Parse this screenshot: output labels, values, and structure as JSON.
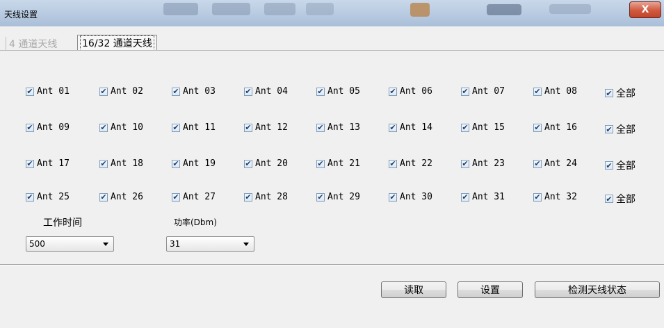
{
  "window": {
    "title": "天线设置",
    "close_glyph": "X"
  },
  "tabs": [
    {
      "label": "4 通道天线",
      "active": false
    },
    {
      "label": "16/32 通道天线",
      "active": true
    }
  ],
  "antennas": {
    "rows": [
      [
        "Ant 01",
        "Ant 02",
        "Ant 03",
        "Ant 04",
        "Ant 05",
        "Ant 06",
        "Ant 07",
        "Ant 08"
      ],
      [
        "Ant 09",
        "Ant 10",
        "Ant 11",
        "Ant 12",
        "Ant 13",
        "Ant 14",
        "Ant 15",
        "Ant 16"
      ],
      [
        "Ant 17",
        "Ant 18",
        "Ant 19",
        "Ant 20",
        "Ant 21",
        "Ant 22",
        "Ant 23",
        "Ant 24"
      ],
      [
        "Ant 25",
        "Ant 26",
        "Ant 27",
        "Ant 28",
        "Ant 29",
        "Ant 30",
        "Ant 31",
        "Ant 32"
      ]
    ],
    "all_label": "全部",
    "checked": true,
    "check_glyph": "✔"
  },
  "params": {
    "work_time_label": "工作时间",
    "work_time_value": "500",
    "power_label": "功率(Dbm)",
    "power_value": "31"
  },
  "buttons": {
    "read": "读取",
    "set": "设置",
    "check_status": "检测天线状态"
  }
}
